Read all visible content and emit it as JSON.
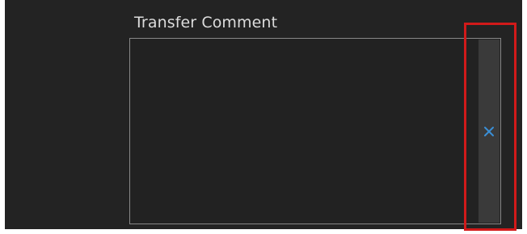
{
  "comment_field": {
    "label": "Transfer Comment",
    "value": "",
    "placeholder": ""
  },
  "clear_button": {
    "icon": "close-icon",
    "color": "#3a8fd6"
  },
  "highlight": {
    "color": "#d11a1a"
  }
}
